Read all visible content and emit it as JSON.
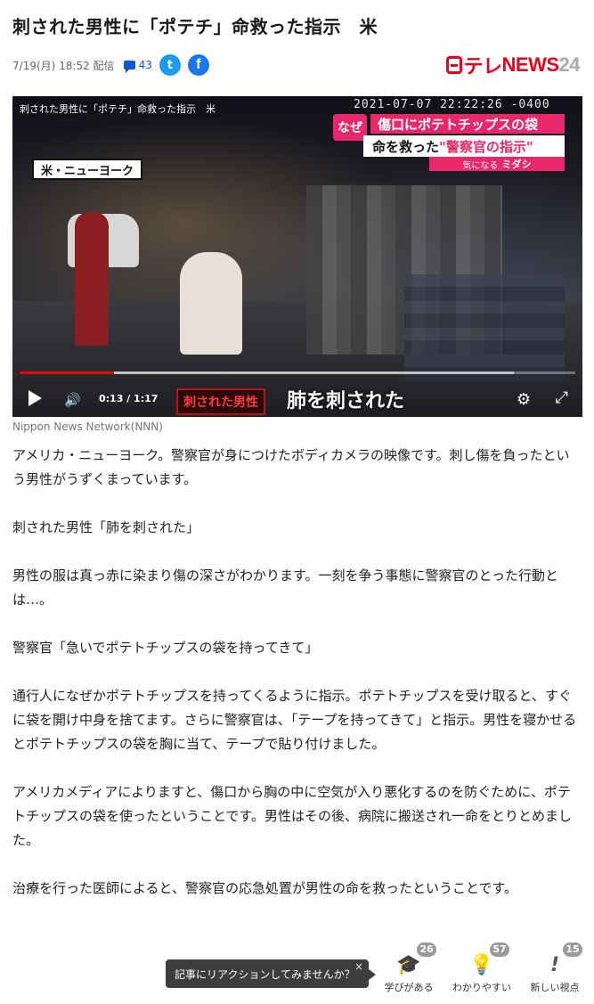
{
  "article": {
    "title": "刺された男性に「ポテチ」命救った指示　米",
    "date": "7/19(月) 18:52",
    "distribution": "配信",
    "comment_count": "43",
    "paragraphs": [
      "アメリカ・ニューヨーク。警察官が身につけたボディカメラの映像です。刺し傷を負ったという男性がうずくまっています。",
      "刺された男性「肺を刺された」",
      "男性の服は真っ赤に染まり傷の深さがわかります。一刻を争う事態に警察官のとった行動とは…。",
      "警察官「急いでポテトチップスの袋を持ってきて」",
      "通行人になぜかポテトチップスを持ってくるように指示。ポテトチップスを受け取ると、すぐに袋を開け中身を捨てます。さらに警察官は、「テープを持ってきて」と指示。男性を寝かせるとポテトチップスの袋を胸に当て、テープで貼り付けました。",
      "アメリカメディアによりますと、傷口から胸の中に空気が入り悪化するのを防ぐために、ポテトチップスの袋を使ったということです。男性はその後、病院に搬送され一命をとりとめました。",
      "治療を行った医師によると、警察官の応急処置が男性の命を救ったということです。"
    ]
  },
  "logo": {
    "mark": "日",
    "tele": "テレ",
    "news": "NEWS",
    "num": "24"
  },
  "video": {
    "overlay_title": "刺された男性に「ポテチ」命救った指示　米",
    "timestamp": "2021-07-07 22:22:26 -0400",
    "tag": "なぜ",
    "caption_line1": "傷口にポテトチップスの袋",
    "caption_line2_prefix": "命を救った",
    "caption_line2_highlight": "\"警察官の指示\"",
    "caption_line3_prefix": "気になる",
    "caption_line3_brand": "ミダシ",
    "location": "米・ニューヨーク",
    "time_display": "0:13 / 1:17",
    "played_fraction": 0.17,
    "loaded_fraction": 0.89,
    "subtitle_speaker": "刺された男性",
    "subtitle_text": "肺を刺された"
  },
  "credit": "Nippon News Network(NNN)",
  "reactions": {
    "tooltip": "記事にリアクションしてみませんか？",
    "close": "×",
    "items": [
      {
        "label": "学びがある",
        "count": "26",
        "icon": "graduation-cap-icon"
      },
      {
        "label": "わかりやすい",
        "count": "57",
        "icon": "lightbulb-icon"
      },
      {
        "label": "新しい視点",
        "count": "15",
        "icon": "exclamation-icon"
      }
    ]
  },
  "colors": {
    "accent": "#e8001c",
    "link": "#0b57d0",
    "caption_pink": "#e8286a"
  }
}
